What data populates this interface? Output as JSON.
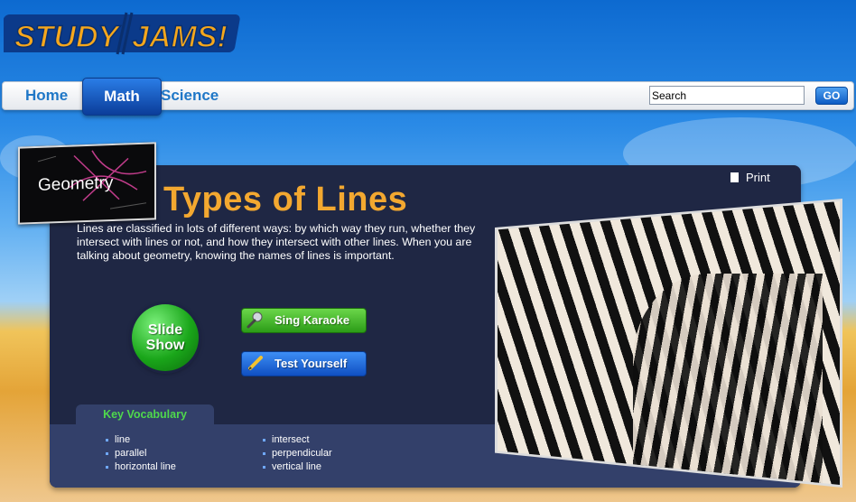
{
  "brand": {
    "logo_text_1": "STUDY",
    "logo_text_2": "JAMS!"
  },
  "nav": {
    "items": [
      {
        "label": "Home"
      },
      {
        "label": "Math"
      },
      {
        "label": "Science"
      }
    ],
    "search_value": "Search",
    "go_label": "GO"
  },
  "topic": {
    "label": "Geometry"
  },
  "page": {
    "title": "Types of Lines",
    "print_label": "Print",
    "intro": "Lines are classified in lots of different ways: by which way they run, whether they intersect with lines or not, and how they intersect with other lines. When you are talking about geometry, knowing the names of lines is important."
  },
  "actions": {
    "slide_show_line1": "Slide",
    "slide_show_line2": "Show",
    "karaoke_label": "Sing Karaoke",
    "test_label": "Test Yourself"
  },
  "vocab": {
    "tab_label": "Key Vocabulary",
    "col1": [
      "line",
      "parallel",
      "horizontal line"
    ],
    "col2": [
      "intersect",
      "perpendicular",
      "vertical line"
    ]
  },
  "colors": {
    "accent_orange": "#f3a830",
    "vocab_green": "#4fd84c",
    "panel_bg": "#1f2744"
  }
}
